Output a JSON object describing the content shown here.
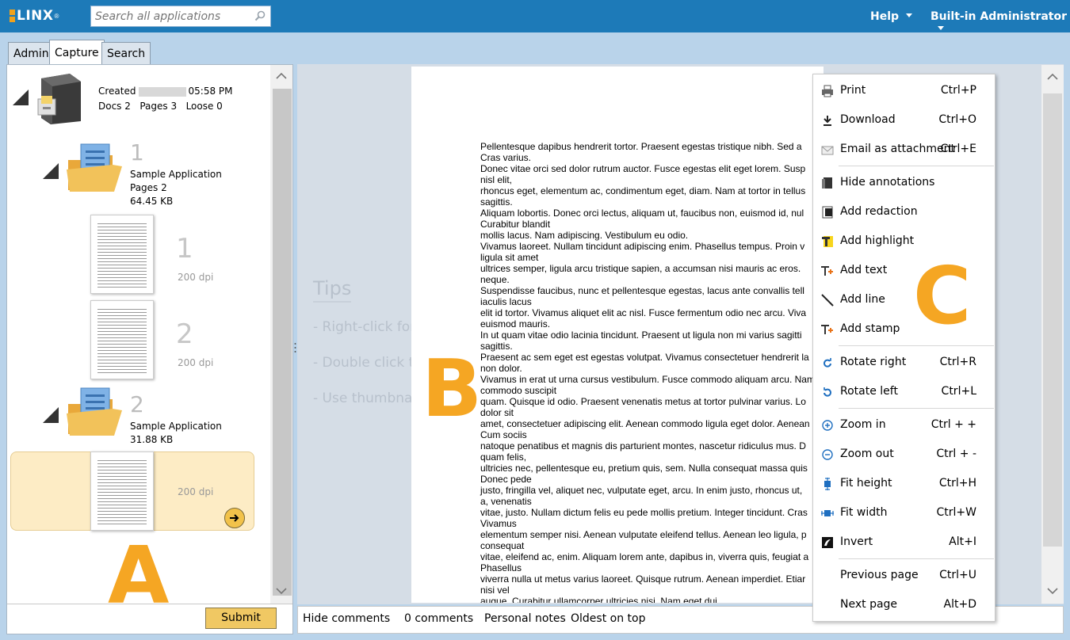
{
  "app": {
    "logo_text": "LINX",
    "logo_mark": "®",
    "search_placeholder": "Search all applications",
    "help_label": "Help",
    "user_label": "Built-in Administrator"
  },
  "tabs": [
    {
      "label": "Admin"
    },
    {
      "label": "Capture"
    },
    {
      "label": "Search"
    }
  ],
  "batch": {
    "created_label": "Created",
    "created_time": "05:58 PM",
    "docs": "Docs 2",
    "pages": "Pages 3",
    "loose": "Loose 0"
  },
  "documents": [
    {
      "number": "1",
      "name": "Sample Application",
      "pages": "Pages 2",
      "size": "64.45 KB"
    },
    {
      "number": "2",
      "name": "Sample Application",
      "size": "31.88 KB"
    }
  ],
  "page_thumbs": [
    {
      "number": "1",
      "dpi": "200 dpi"
    },
    {
      "number": "2",
      "dpi": "200 dpi"
    },
    {
      "dpi": "200 dpi"
    }
  ],
  "submit_label": "Submit",
  "letters": {
    "a": "A",
    "b": "B",
    "c": "C"
  },
  "tips": {
    "title": "Tips",
    "items": [
      "- Right-click for",
      "- Double click to",
      "- Use thumbnai"
    ]
  },
  "document_lines": [
    "Pellentesque dapibus hendrerit tortor. Praesent egestas tristique nibh. Sed a",
    "Cras varius.",
    "Donec vitae orci sed dolor rutrum auctor. Fusce egestas elit eget lorem. Susp",
    "nisl elit,",
    "rhoncus eget, elementum ac, condimentum eget, diam. Nam at tortor in tellus",
    "sagittis.",
    "Aliquam lobortis. Donec orci lectus, aliquam ut, faucibus non, euismod id, nul",
    "Curabitur blandit",
    "mollis lacus. Nam adipiscing. Vestibulum eu odio.",
    "Vivamus laoreet. Nullam tincidunt adipiscing enim. Phasellus tempus. Proin v",
    "ligula sit amet",
    "ultrices semper, ligula arcu tristique sapien, a accumsan nisi mauris ac eros.",
    "neque.",
    "Suspendisse faucibus, nunc et pellentesque egestas, lacus ante convallis tell",
    "iaculis lacus",
    "elit id tortor. Vivamus aliquet elit ac nisl. Fusce fermentum odio nec arcu. Viva",
    "euismod mauris.",
    "In ut quam vitae odio lacinia tincidunt. Praesent ut ligula non mi varius sagitti",
    "sagittis.",
    "Praesent ac sem eget est egestas volutpat. Vivamus consectetuer hendrerit la",
    "non dolor.",
    "Vivamus in erat ut urna cursus vestibulum. Fusce commodo aliquam arcu. Nam",
    "commodo suscipit",
    "quam. Quisque id odio. Praesent venenatis metus at tortor pulvinar varius. Lo",
    "dolor sit",
    "amet, consectetuer adipiscing elit. Aenean commodo ligula eget dolor. Aenean",
    "Cum sociis",
    "natoque penatibus et magnis dis parturient montes, nascetur ridiculus mus. D",
    "quam felis,",
    "ultricies nec, pellentesque eu, pretium quis, sem. Nulla consequat massa quis",
    "Donec pede",
    "justo, fringilla vel, aliquet nec, vulputate eget, arcu. In enim justo, rhoncus ut,",
    "a, venenatis",
    "vitae, justo. Nullam dictum felis eu pede mollis pretium. Integer tincidunt. Cras",
    "Vivamus",
    "elementum semper nisi. Aenean vulputate eleifend tellus. Aenean leo ligula, p",
    "consequat",
    "vitae, eleifend ac, enim. Aliquam lorem ante, dapibus in, viverra quis, feugiat a",
    "Phasellus",
    "viverra nulla ut metus varius laoreet. Quisque rutrum. Aenean imperdiet. Etiar",
    "nisi vel",
    "augue. Curabitur ullamcorper ultricies nisi. Nam eget dui."
  ],
  "comments_bar": {
    "hide_comments": "Hide comments",
    "count": "0 comments",
    "personal_notes": "Personal notes",
    "order": "Oldest on top"
  },
  "context_menu": [
    {
      "label": "Print",
      "shortcut": "Ctrl+P",
      "icon": "printer-icon"
    },
    {
      "label": "Download",
      "shortcut": "Ctrl+O",
      "icon": "download-icon"
    },
    {
      "label": "Email as attachment",
      "shortcut": "Ctrl+E",
      "icon": "envelope-icon"
    },
    {
      "label": "Hide annotations",
      "shortcut": "",
      "icon": "hide-annotations-icon"
    },
    {
      "label": "Add redaction",
      "shortcut": "",
      "icon": "redaction-icon"
    },
    {
      "label": "Add highlight",
      "shortcut": "",
      "icon": "highlight-icon"
    },
    {
      "label": "Add text",
      "shortcut": "",
      "icon": "add-text-icon"
    },
    {
      "label": "Add line",
      "shortcut": "",
      "icon": "line-icon"
    },
    {
      "label": "Add stamp",
      "shortcut": "",
      "icon": "stamp-icon"
    },
    {
      "label": "Rotate right",
      "shortcut": "Ctrl+R",
      "icon": "rotate-right-icon"
    },
    {
      "label": "Rotate left",
      "shortcut": "Ctrl+L",
      "icon": "rotate-left-icon"
    },
    {
      "label": "Zoom in",
      "shortcut": "Ctrl + +",
      "icon": "zoom-in-icon"
    },
    {
      "label": "Zoom out",
      "shortcut": "Ctrl + -",
      "icon": "zoom-out-icon"
    },
    {
      "label": "Fit height",
      "shortcut": "Ctrl+H",
      "icon": "fit-height-icon"
    },
    {
      "label": "Fit width",
      "shortcut": "Ctrl+W",
      "icon": "fit-width-icon"
    },
    {
      "label": "Invert",
      "shortcut": "Alt+I",
      "icon": "invert-icon"
    },
    {
      "label": "Previous page",
      "shortcut": "Ctrl+U",
      "icon": ""
    },
    {
      "label": "Next page",
      "shortcut": "Alt+D",
      "icon": ""
    }
  ],
  "colors": {
    "topbar": "#1d7ab8",
    "accent_orange": "#f5a623",
    "selected_bg": "#fdecc5",
    "submit_bg": "#f0c863"
  }
}
